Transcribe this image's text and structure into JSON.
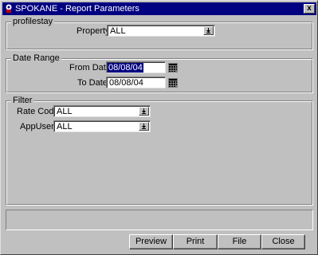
{
  "window": {
    "title": "SPOKANE - Report Parameters",
    "close_symbol": "x"
  },
  "groups": {
    "profilestay": {
      "label": "profilestay",
      "property": {
        "label": "Property",
        "value": "ALL"
      }
    },
    "date_range": {
      "label": "Date Range",
      "from_date": {
        "label": "From Date",
        "value": "08/08/04"
      },
      "to_date": {
        "label": "To Date",
        "value": "08/08/04"
      }
    },
    "filter": {
      "label": "Filter",
      "rate_code": {
        "label": "Rate Code",
        "value": "ALL"
      },
      "appuser": {
        "label": "AppUser",
        "value": "ALL"
      }
    }
  },
  "buttons": {
    "preview": "Preview",
    "print": "Print",
    "file": "File",
    "close": "Close"
  },
  "icons": {
    "app": "opera-app-icon",
    "dropdown": "dropdown-arrow-icon",
    "calendar": "calendar-icon"
  },
  "colors": {
    "titlebar": "#000080",
    "face": "#c0c0c0",
    "selection": "#000080"
  }
}
